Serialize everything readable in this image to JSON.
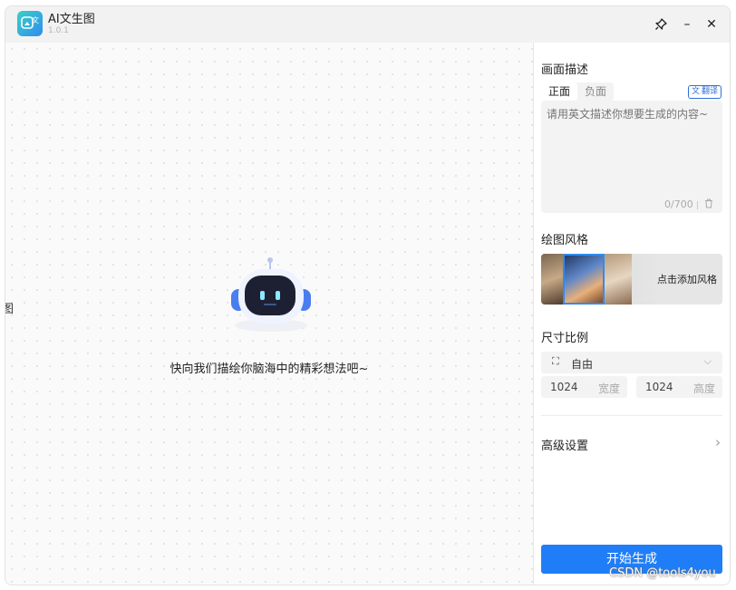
{
  "app": {
    "title": "AI文生图",
    "version": "1.0.1"
  },
  "window_controls": {
    "pin": "pin-icon",
    "minimize": "–",
    "close": "✕"
  },
  "canvas": {
    "hint": "快向我们描绘你脑海中的精彩想法吧~",
    "edge_char": "图"
  },
  "description": {
    "title": "画面描述",
    "tabs": [
      {
        "label": "正面",
        "active": true
      },
      {
        "label": "负面",
        "active": false
      }
    ],
    "translate_label": "翻译",
    "placeholder": "请用英文描述你想要生成的内容~",
    "counter": "0/700"
  },
  "style": {
    "title": "绘图风格",
    "add_label": "点击添加风格"
  },
  "size": {
    "title": "尺寸比例",
    "ratio_value": "自由",
    "width_value": "1024",
    "width_label": "宽度",
    "height_value": "1024",
    "height_label": "高度"
  },
  "advanced": {
    "label": "高级设置"
  },
  "generate": {
    "label": "开始生成"
  },
  "watermark": "CSDN @tools4you",
  "colors": {
    "accent": "#1f7ef7",
    "robot_blue": "#4a7df0",
    "robot_face": "#1d2033",
    "robot_eye": "#8ee8ff"
  }
}
